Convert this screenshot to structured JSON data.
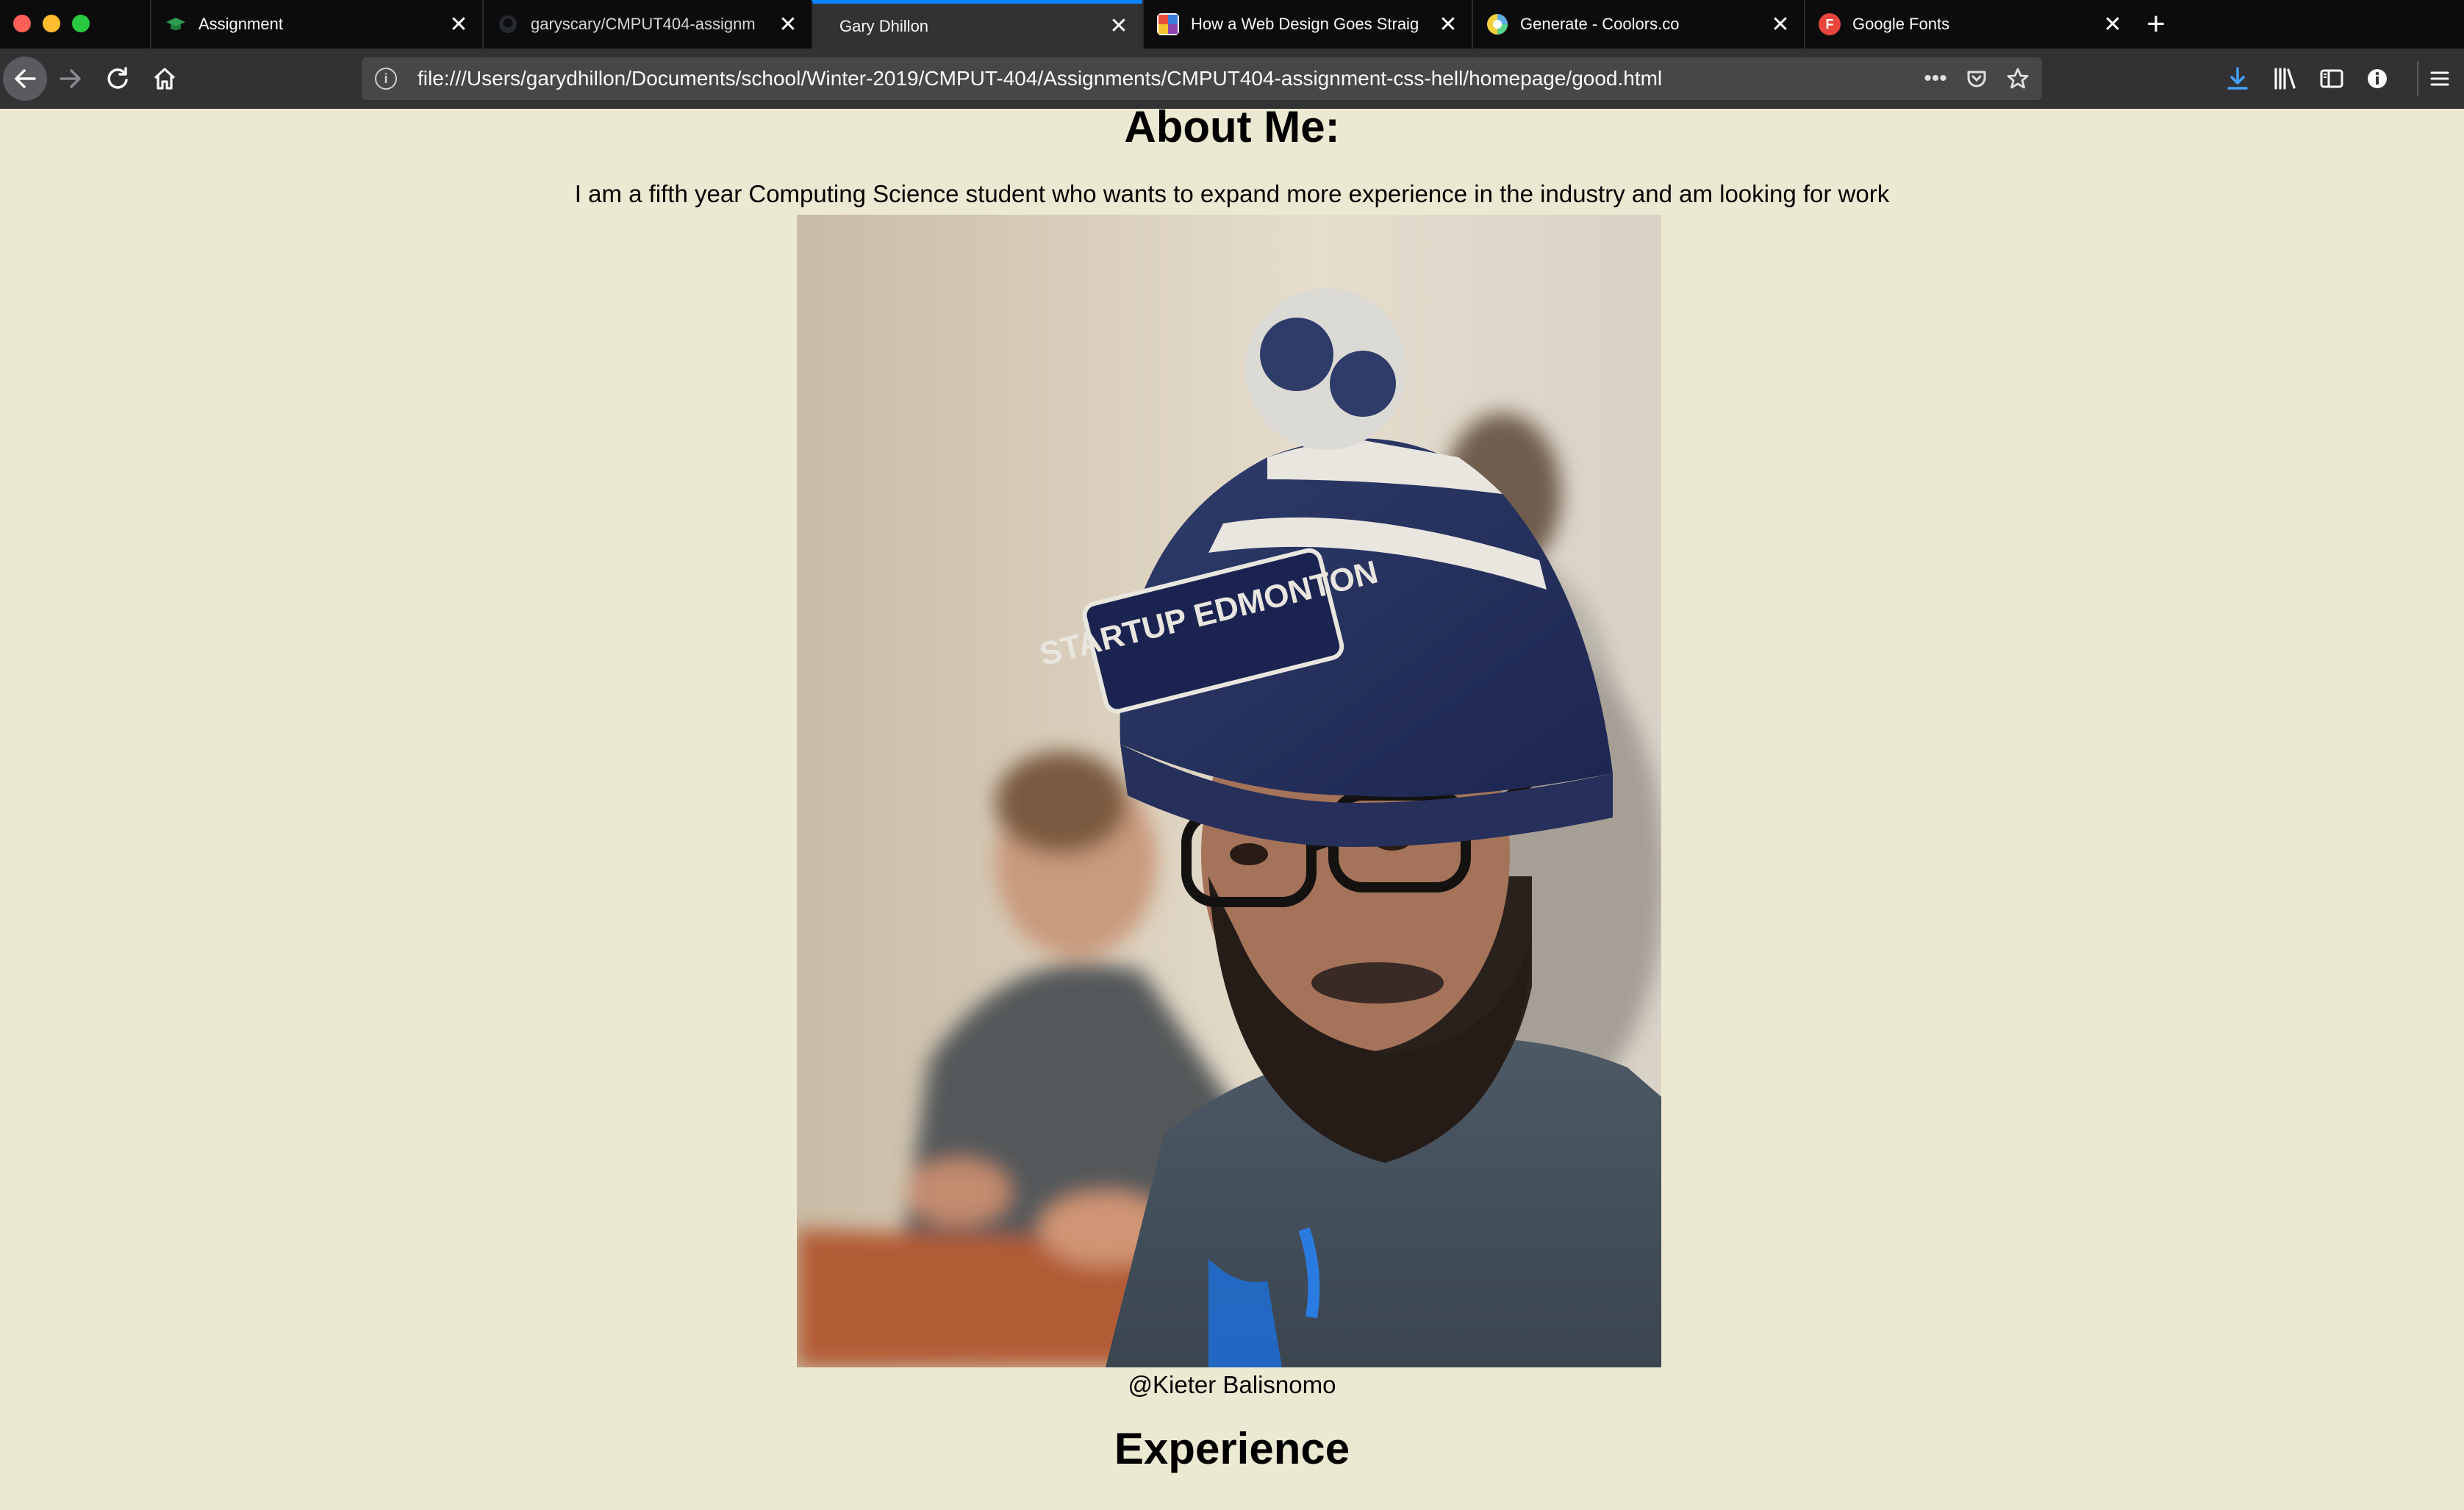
{
  "browser": {
    "tabs": [
      {
        "title": "Assignment",
        "favicon": "graduation-cap-icon",
        "favicon_color": "#1f7a3a",
        "active": false
      },
      {
        "title": "garyscary/CMPUT404-assignm",
        "favicon": "github-icon",
        "favicon_color": "#24292e",
        "active": false
      },
      {
        "title": "Gary Dhillon",
        "favicon": "",
        "favicon_color": "",
        "active": true
      },
      {
        "title": "How a Web Design Goes Straig",
        "favicon": "article-icon",
        "favicon_color": "#e84c3d",
        "active": false
      },
      {
        "title": "Generate - Coolors.co",
        "favicon": "coolors-icon",
        "favicon_color": "#7fd34e",
        "active": false
      },
      {
        "title": "Google Fonts",
        "favicon": "google-fonts-icon",
        "favicon_color": "#e8453c",
        "active": false
      }
    ],
    "favicon_letters": {
      "google_fonts": "F"
    },
    "url": "file:///Users/garydhillon/Documents/school/Winter-2019/CMPUT-404/Assignments/CMPUT404-assignment-css-hell/homepage/good.html",
    "accent_color": "#0a84ff"
  },
  "page": {
    "background": "#ece9d2",
    "about_heading": "About Me:",
    "about_text": "I am a fifth year Computing Science student who wants to expand more experience in the industry and am looking for work",
    "photo_credit": "@Kieter Balisnomo",
    "experience_heading": "Experience",
    "hat_text": "STARTUP EDMONTON"
  }
}
